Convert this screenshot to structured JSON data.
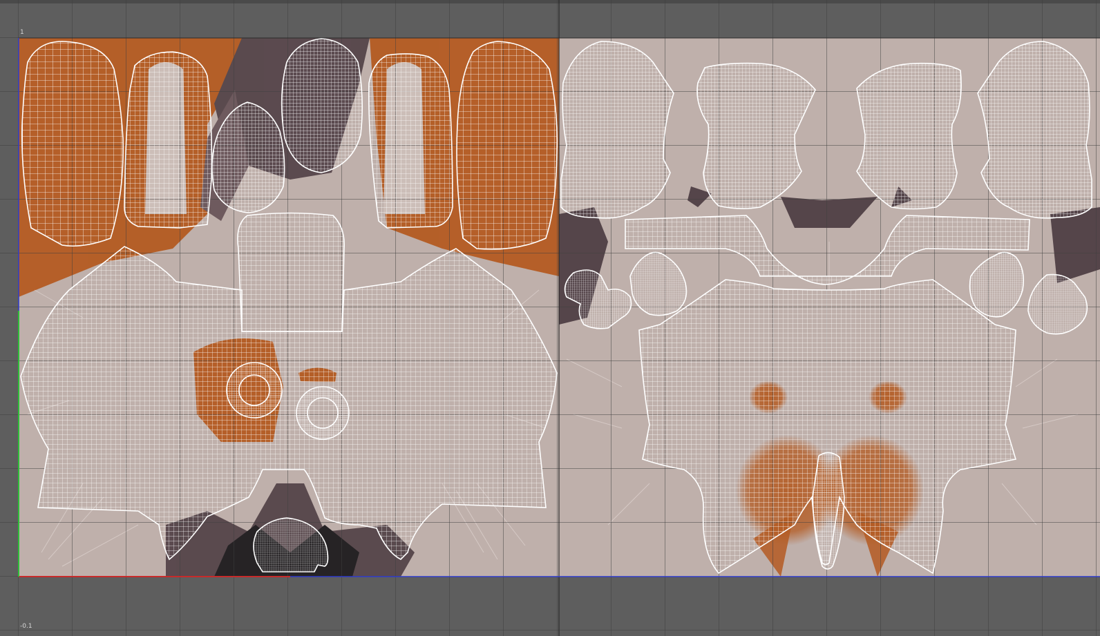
{
  "editor": {
    "view": "uv-texture-editor",
    "tiles": [
      "tile-0-1",
      "tile-1-1"
    ]
  },
  "axis": {
    "label_top": "1",
    "label_bottom": "-0.1"
  },
  "colors": {
    "background": "#5e5e5e",
    "grid_line": "#3f3f3f",
    "texture_base": "#bfb0ab",
    "texture_orange": "#b45b22",
    "texture_dark": "#55454a",
    "texture_black": "#1e1c1e",
    "uv_wire": "#ffffff",
    "axis_u": "#c82a2a",
    "axis_v": "#2fbf39",
    "axis_blue": "#2f3bcc"
  },
  "shells": [
    "ear-outer-left",
    "ear-inner-left",
    "nose-tip",
    "head-top-cap",
    "ear-inner-right",
    "ear-outer-right",
    "muzzle-strip",
    "head-face",
    "left-eye-ring",
    "right-eye-ring",
    "mouth-interior",
    "arm-left-back",
    "arm-left-front",
    "arm-right-front",
    "arm-right-back",
    "collar-strip",
    "hand-left-1",
    "hand-left-2",
    "hand-right-1",
    "hand-right-2",
    "body-torso",
    "tail"
  ]
}
